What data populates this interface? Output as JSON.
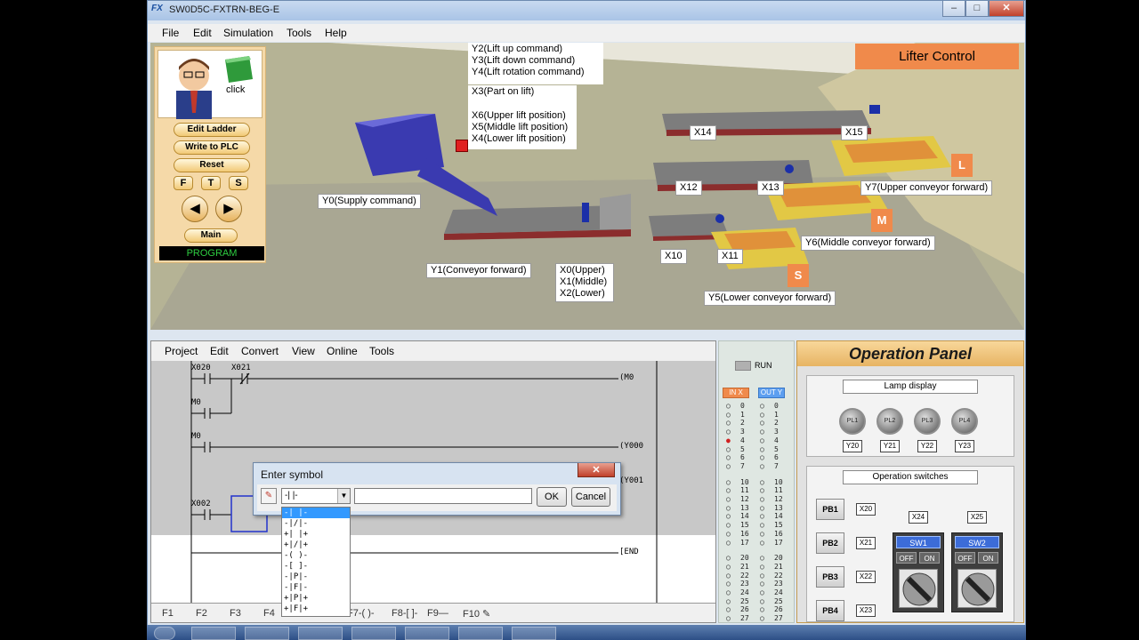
{
  "window": {
    "title": "SW0D5C-FXTRN-BEG-E",
    "min": "–",
    "max": "□",
    "close": "✕"
  },
  "menu": [
    "File",
    "Edit",
    "Simulation",
    "Tools",
    "Help"
  ],
  "scene": {
    "title_box": "Lifter Control",
    "labels": {
      "y2": "Y2(Lift up command)",
      "y3": "Y3(Lift down command)",
      "y4": "Y4(Lift rotation command)",
      "x3": "X3(Part on lift)",
      "x6": "X6(Upper lift position)",
      "x5": "X5(Middle lift position)",
      "x4": "X4(Lower lift position)",
      "y0": "Y0(Supply command)",
      "y1": "Y1(Conveyor forward)",
      "x0": "X0(Upper)",
      "x1": "X1(Middle)",
      "x2": "X2(Lower)",
      "x10": "X10",
      "x11": "X11",
      "x12": "X12",
      "x13": "X13",
      "x14": "X14",
      "x15": "X15",
      "y5": "Y5(Lower conveyor forward)",
      "y6": "Y6(Middle conveyor forward)",
      "y7": "Y7(Upper conveyor forward)",
      "tag_l": "L",
      "tag_m": "M",
      "tag_s": "S"
    }
  },
  "control": {
    "click_text": "click",
    "buttons": {
      "edit_ladder": "Edit Ladder",
      "write_plc": "Write to PLC",
      "reset": "Reset",
      "f": "F",
      "t": "T",
      "s": "S",
      "prev": "◀",
      "next": "▶",
      "main": "Main"
    },
    "status": "PROGRAM"
  },
  "ladder": {
    "menu": [
      "Project",
      "Edit",
      "Convert",
      "View",
      "Online",
      "Tools"
    ],
    "contacts": {
      "c1": "X020",
      "c2": "X021",
      "c3": "M0",
      "c4": "M0",
      "c5": "X002"
    },
    "coils": {
      "m0": "(M0",
      "y000": "(Y000",
      "y001": "(Y001",
      "end": "[END"
    },
    "toolbar": [
      "F1",
      "F2",
      "F3",
      "F4",
      "F5",
      "F6",
      "F7",
      "F8",
      "F9",
      "F10"
    ],
    "toolbar_symbols": {
      "f7": "F7-( )-",
      "f8": "F8-[ ]-",
      "f9": "F9—",
      "f10": "F10 ✎"
    }
  },
  "dialog": {
    "title": "Enter symbol",
    "close": "✕",
    "combo_value": "-| |-",
    "text_value": "",
    "ok": "OK",
    "cancel": "Cancel",
    "options": [
      "-| |-",
      "-|/|-",
      "+| |+",
      "+|/|+",
      "-( )-",
      "-[ ]-",
      "-|P|-",
      "-|F|-",
      "+|P|+",
      "+|F|+"
    ]
  },
  "io": {
    "run": "RUN",
    "in": "IN X",
    "out": "OUT Y",
    "rows": [
      "0",
      "1",
      "2",
      "3",
      "4",
      "5",
      "6",
      "7",
      "10",
      "11",
      "12",
      "13",
      "14",
      "15",
      "16",
      "17",
      "20",
      "21",
      "22",
      "23",
      "24",
      "25",
      "26",
      "27"
    ],
    "active_in": "4"
  },
  "panel": {
    "title": "Operation Panel",
    "lamp_group": "Lamp display",
    "lamps": [
      {
        "name": "PL1",
        "tag": "Y20"
      },
      {
        "name": "PL2",
        "tag": "Y21"
      },
      {
        "name": "PL3",
        "tag": "Y22"
      },
      {
        "name": "PL4",
        "tag": "Y23"
      }
    ],
    "switch_group": "Operation switches",
    "pbs": [
      {
        "name": "PB1",
        "tag": "X20"
      },
      {
        "name": "PB2",
        "tag": "X21"
      },
      {
        "name": "PB3",
        "tag": "X22"
      },
      {
        "name": "PB4",
        "tag": "X23"
      }
    ],
    "switches": [
      {
        "name": "SW1",
        "tag": "X24"
      },
      {
        "name": "SW2",
        "tag": "X25"
      }
    ],
    "off": "OFF",
    "on": "ON"
  },
  "colors": {
    "accent": "#f08a4b",
    "status_green": "#2ecc40",
    "selection": "#3399ff"
  }
}
